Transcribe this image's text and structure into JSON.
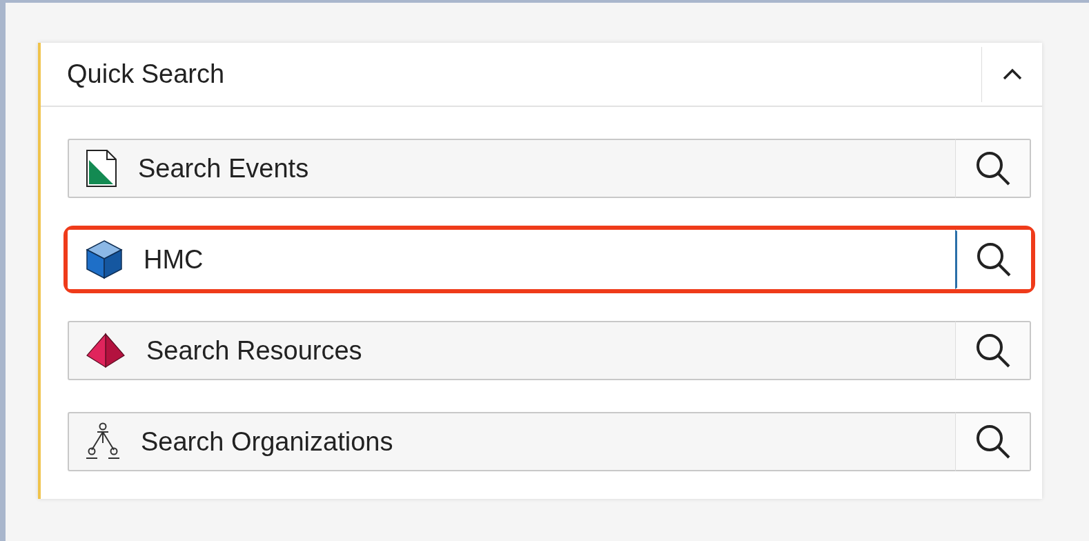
{
  "panel": {
    "title": "Quick Search",
    "expanded": true
  },
  "fields": [
    {
      "kind": "document",
      "placeholder": "Search Events",
      "focused": false,
      "highlighted": false
    },
    {
      "kind": "cube",
      "value": "HMC",
      "focused": true,
      "highlighted": true
    },
    {
      "kind": "pyramid",
      "placeholder": "Search Resources",
      "focused": false,
      "highlighted": false
    },
    {
      "kind": "organization",
      "placeholder": "Search Organizations",
      "focused": false,
      "highlighted": false
    }
  ]
}
